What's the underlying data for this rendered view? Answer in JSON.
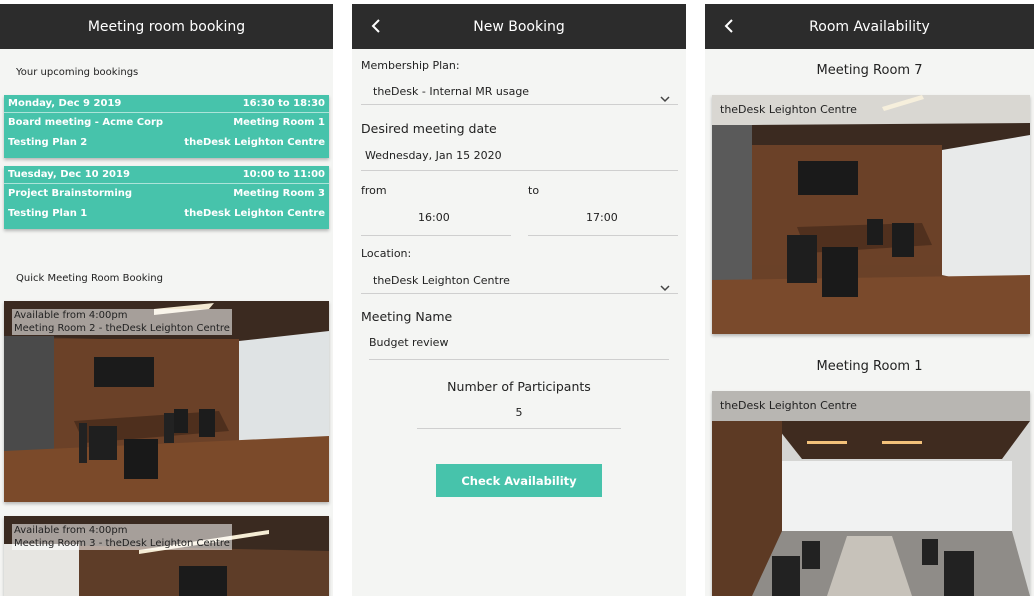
{
  "screen1": {
    "title": "Meeting room booking",
    "upcoming_label": "Your upcoming bookings",
    "bookings": [
      {
        "date": "Monday, Dec 9 2019",
        "time": "16:30 to 18:30",
        "name": "Board meeting - Acme Corp",
        "room": "Meeting Room 1",
        "plan": "Testing Plan 2",
        "location": "theDesk Leighton Centre"
      },
      {
        "date": "Tuesday, Dec 10 2019",
        "time": "10:00 to 11:00",
        "name": "Project Brainstorming",
        "room": "Meeting Room 3",
        "plan": "Testing Plan 1",
        "location": "theDesk Leighton Centre"
      }
    ],
    "quick_label": "Quick Meeting Room Booking",
    "quick_rooms": [
      {
        "available": "Available from  4:00pm",
        "room": "Meeting Room 2 - theDesk Leighton Centre"
      },
      {
        "available": "Available from  4:00pm",
        "room": "Meeting Room 3 - theDesk Leighton Centre"
      }
    ]
  },
  "screen2": {
    "title": "New Booking",
    "membership_label": "Membership Plan:",
    "membership_value": "theDesk - Internal MR usage",
    "date_label": "Desired meeting date",
    "date_value": "Wednesday, Jan 15 2020",
    "from_label": "from",
    "from_value": "16:00",
    "to_label": "to",
    "to_value": "17:00",
    "location_label": "Location:",
    "location_value": "theDesk Leighton Centre",
    "meeting_name_label": "Meeting Name",
    "meeting_name_value": "Budget review",
    "participants_label": "Number of Participants",
    "participants_value": "5",
    "check_button": "Check Availability"
  },
  "screen3": {
    "title": "Room Availability",
    "rooms": [
      {
        "title": "Meeting Room 7",
        "location": "theDesk Leighton Centre"
      },
      {
        "title": "Meeting Room 1",
        "location": "theDesk Leighton Centre"
      }
    ]
  },
  "icons": {
    "back": "chevron-left-icon",
    "dropdown": "chevron-down-icon"
  },
  "colors": {
    "topbar": "#2c2c2c",
    "accent": "#47c3ab",
    "background": "#f4f5f3"
  }
}
